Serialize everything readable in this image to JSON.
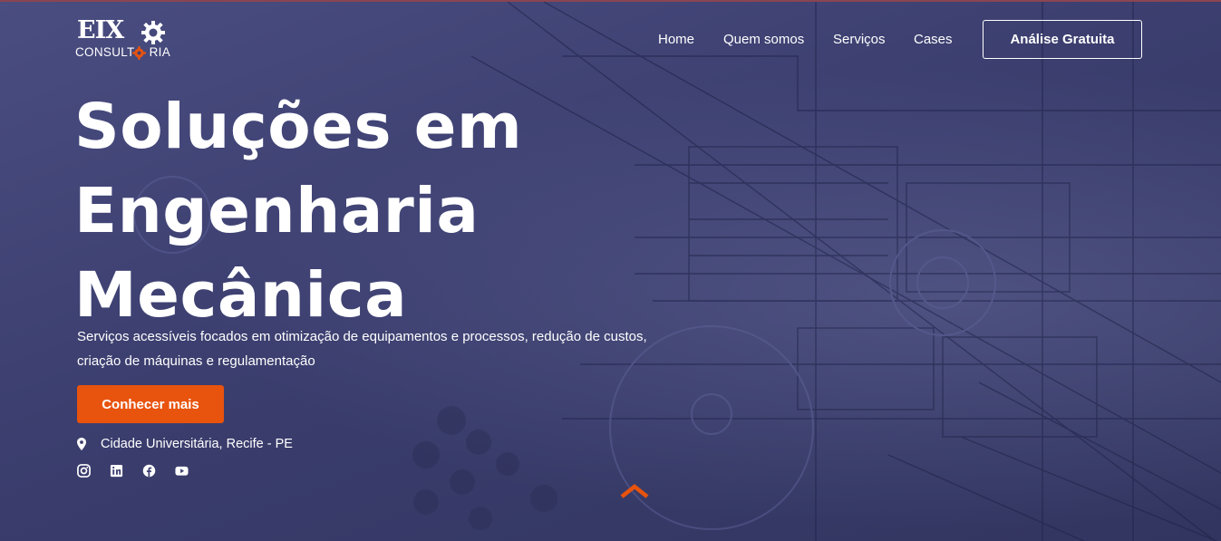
{
  "brand": {
    "logo_main": "EIX",
    "logo_sub_left": "CONSULT",
    "logo_sub_right": "RIA",
    "accent_color": "#e8530e"
  },
  "nav": {
    "items": [
      {
        "label": "Home"
      },
      {
        "label": "Quem somos"
      },
      {
        "label": "Serviços"
      },
      {
        "label": "Cases"
      }
    ],
    "cta_label": "Análise Gratuita"
  },
  "hero": {
    "headline_lines": [
      "Soluções em",
      "Engenharia",
      "Mecânica"
    ],
    "subtitle": "Serviços acessíveis focados em otimização de equipamentos e processos, redução de custos, criação de máquinas e regulamentação",
    "primary_button": "Conhecer mais",
    "location_icon": "map-pin-icon",
    "location": "Cidade Universitária, Recife - PE",
    "socials": [
      "instagram-icon",
      "linkedin-icon",
      "facebook-icon",
      "youtube-icon"
    ],
    "scroll_icon": "chevron-up-icon"
  }
}
